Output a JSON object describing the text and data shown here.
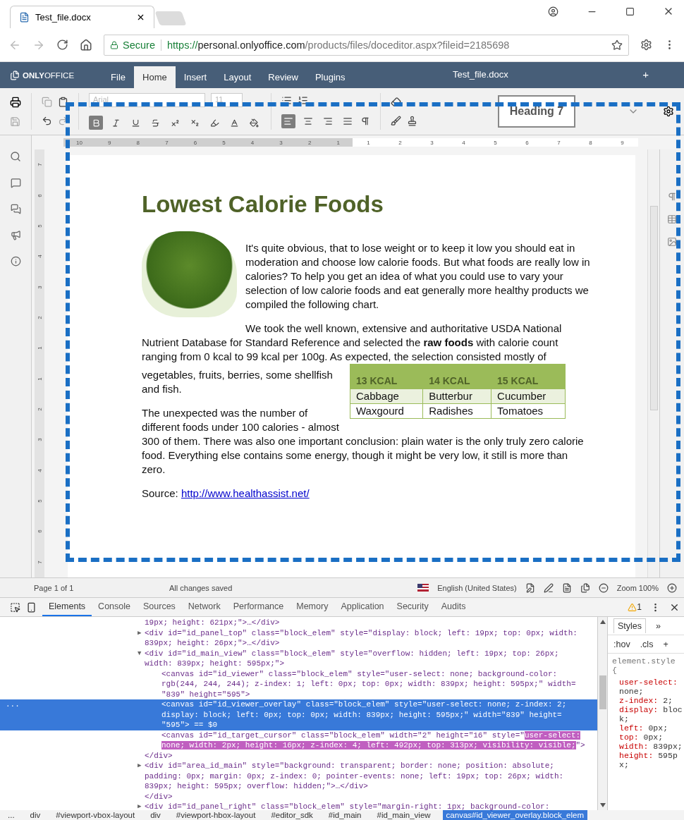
{
  "browser": {
    "tab_title": "Test_file.docx",
    "url": {
      "secure_label": "Secure",
      "scheme": "https://",
      "host": "personal.onlyoffice.com",
      "path": "/products/files/doceditor.aspx?fileid=2185698"
    }
  },
  "editor_header": {
    "logo_bold": "ONLY",
    "logo_light": "OFFICE",
    "title": "Test_file.docx",
    "plus": "+",
    "menu": [
      {
        "label": "File",
        "selected": false
      },
      {
        "label": "Home",
        "selected": true
      },
      {
        "label": "Insert",
        "selected": false
      },
      {
        "label": "Layout",
        "selected": false
      },
      {
        "label": "Review",
        "selected": false
      },
      {
        "label": "Plugins",
        "selected": false
      }
    ]
  },
  "toolbar": {
    "font_name": "Arial",
    "font_size": "11",
    "style_preview": "Heading 7",
    "format": [
      {
        "kind": "bold",
        "active": true
      },
      {
        "kind": "italic",
        "active": false
      },
      {
        "kind": "underline",
        "active": false
      },
      {
        "kind": "strike",
        "active": false
      },
      {
        "kind": "superscript",
        "active": false
      },
      {
        "kind": "subscript",
        "active": false
      },
      {
        "kind": "highlight",
        "active": false
      },
      {
        "kind": "fontcolor",
        "active": false
      },
      {
        "kind": "fill",
        "active": false
      }
    ],
    "align": [
      {
        "kind": "left",
        "active": true
      },
      {
        "kind": "center",
        "active": false
      },
      {
        "kind": "right",
        "active": false
      },
      {
        "kind": "justify",
        "active": false
      }
    ]
  },
  "ruler": {
    "left_numbers": [
      "10",
      "9",
      "8",
      "7",
      "6",
      "5",
      "4",
      "3",
      "2",
      "1"
    ],
    "right_numbers": [
      "1",
      "2",
      "3",
      "4",
      "5",
      "6",
      "7",
      "8",
      "9"
    ],
    "vertical_numbers": [
      "7",
      "6",
      "5",
      "4",
      "3",
      "2",
      "1",
      "1",
      "2",
      "3",
      "4",
      "5",
      "6",
      "7"
    ]
  },
  "document": {
    "title": "Lowest Calorie Foods",
    "paragraphs": [
      "It's quite obvious, that to lose weight or to keep it low you should eat in moderation and choose low calorie foods. But what foods are really low in calories? To help you get an idea of what you could use to vary your selection of low calorie foods and eat generally more healthy products we compiled the following chart.",
      "We took the well known, extensive and authoritative USDA National Nutrient Database for Standard Reference and selected the **raw foods** with calorie count ranging from 0 kcal to 99 kcal per 100g. As expected, the selection consisted mostly of"
    ],
    "beside_table": [
      "vegetables, fruits, berries, some shellfish and fish.",
      "The unexpected was the number of different foods under 100 calories - almost"
    ],
    "after_table": "300 of them. There was also one important conclusion: plain water is the only truly zero calorie food. Everything else contains some energy, though it might be very low, it still is more than zero.",
    "table": {
      "columns": [
        "13 KCAL",
        "14 KCAL",
        "15 KCAL"
      ],
      "rows": [
        [
          "Cabbage",
          "Butterbur",
          "Cucumber"
        ],
        [
          "Waxgourd",
          "Radishes",
          "Tomatoes"
        ]
      ]
    },
    "source": {
      "label": "Source:",
      "link": "http://www.healthassist.net/"
    }
  },
  "status_bar": {
    "page": "Page 1 of 1",
    "save_state": "All changes saved",
    "language": "English (United States)",
    "zoom": "Zoom 100%"
  },
  "devtools": {
    "tabs": [
      {
        "label": "Elements",
        "selected": true
      },
      {
        "label": "Console",
        "selected": false
      },
      {
        "label": "Sources",
        "selected": false
      },
      {
        "label": "Network",
        "selected": false
      },
      {
        "label": "Performance",
        "selected": false
      },
      {
        "label": "Memory",
        "selected": false
      },
      {
        "label": "Application",
        "selected": false
      },
      {
        "label": "Security",
        "selected": false
      },
      {
        "label": "Audits",
        "selected": false
      }
    ],
    "warnings": "1",
    "selected_gutter": "...",
    "nodes": [
      {
        "selected": false,
        "lines": [
          "19px; height: 621px;\">…</div>"
        ]
      },
      {
        "toggle": "▶",
        "selected": false,
        "lines": [
          "<div id=\"id_panel_top\" class=\"block_elem\" style=\"display: block; left: 19px; top: 0px; width:",
          "839px; height: 26px;\">…</div>"
        ]
      },
      {
        "toggle": "▼",
        "selected": false,
        "lines": [
          "<div id=\"id_main_view\" class=\"block_elem\" style=\"overflow: hidden; left: 19px; top: 26px;",
          "width: 839px; height: 595px;\">"
        ],
        "children": [
          {
            "selected": false,
            "lines": [
              "<canvas id=\"id_viewer\" class=\"block_elem\" style=\"user-select: none; background-color:",
              "rgb(244, 244, 244); z-index: 1; left: 0px; top: 0px; width: 839px; height: 595px;\" width=",
              "\"839\" height=\"595\">"
            ]
          },
          {
            "selected": true,
            "lines": [
              "<canvas id=\"id_viewer_overlay\" class=\"block_elem\" style=\"user-select: none; z-index: 2;",
              "display: block; left: 0px; top: 0px; width: 839px; height: 595px;\" width=\"839\" height=",
              "\"595\"> == $0"
            ]
          },
          {
            "selected": false,
            "lines": [
              [
                {
                  "text": "<canvas id=\"id_target_cursor\" class=\"block_elem\" width=\"2\" height=\"16\" style=\"",
                  "marked": false
                },
                {
                  "text": "user-select:",
                  "marked": true
                }
              ],
              [
                {
                  "text": "none; width: 2px; height: 16px; z-index: 4; left: 492px; top: 313px; visibility: visible;",
                  "marked": true
                },
                {
                  "text": "\">",
                  "marked": false
                }
              ]
            ]
          }
        ],
        "closing": "</div>"
      },
      {
        "toggle": "▶",
        "selected": false,
        "lines": [
          "<div id=\"area_id_main\" style=\"background: transparent; border: none; position: absolute;",
          "padding: 0px; margin: 0px; z-index: 0; pointer-events: none; left: 19px; top: 26px; width:",
          "839px; height: 595px; overflow: hidden;\">…</div>"
        ]
      },
      {
        "selected": false,
        "lines": [
          "</div>"
        ]
      },
      {
        "toggle": "▶",
        "selected": false,
        "lines": [
          "<div id=\"id_panel_right\" class=\"block_elem\" style=\"margin-right: 1px; background-color:"
        ]
      }
    ],
    "styles": {
      "tab": "Styles",
      "more": "»",
      "hov": ":hov",
      "cls": ".cls",
      "add": "+",
      "selector": "element.style {",
      "props": [
        {
          "name": "user-select:",
          "value": "none;"
        },
        {
          "name": "z-index:",
          "value": "2;"
        },
        {
          "name": "display:",
          "value": "block;"
        },
        {
          "name": "left:",
          "value": "0px;"
        },
        {
          "name": "top:",
          "value": "0px;"
        },
        {
          "name": "width:",
          "value": "839px;"
        },
        {
          "name": "height:",
          "value": "595px;"
        }
      ]
    },
    "breadcrumbs": [
      {
        "label": "...",
        "selected": false
      },
      {
        "label": "div",
        "selected": false
      },
      {
        "label": "#viewport-vbox-layout",
        "selected": false
      },
      {
        "label": "div",
        "selected": false
      },
      {
        "label": "#viewport-hbox-layout",
        "selected": false
      },
      {
        "label": "#editor_sdk",
        "selected": false
      },
      {
        "label": "#id_main",
        "selected": false
      },
      {
        "label": "#id_main_view",
        "selected": false
      },
      {
        "label": "canvas#id_viewer_overlay.block_elem",
        "selected": true
      }
    ]
  },
  "annotation": {
    "dashed_frame": true
  }
}
